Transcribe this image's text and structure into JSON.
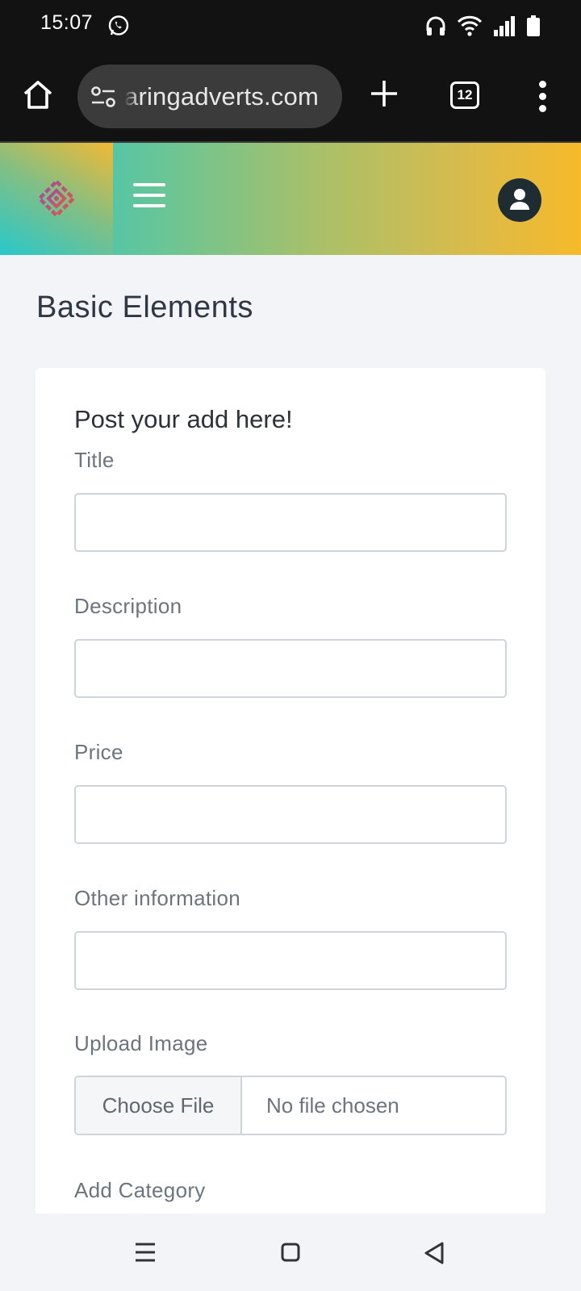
{
  "status_bar": {
    "time": "15:07",
    "icons": [
      "whatsapp-icon",
      "headphones-icon",
      "wifi-icon",
      "signal-icon",
      "battery-icon"
    ]
  },
  "browser": {
    "url": "aringadverts.com",
    "tab_count": "12",
    "icons": [
      "home-icon",
      "site-settings-icon",
      "plus-icon",
      "more-vert-icon"
    ]
  },
  "header": {
    "gradient_colors": [
      "#2fc4c6",
      "#a9c069",
      "#f6ba2a"
    ],
    "icons": [
      "brand-logo",
      "hamburger-icon",
      "user-icon"
    ]
  },
  "page": {
    "title": "Basic Elements"
  },
  "form": {
    "heading": "Post your add here!",
    "fields": {
      "title": {
        "label": "Title",
        "value": ""
      },
      "description": {
        "label": "Description",
        "value": ""
      },
      "price": {
        "label": "Price",
        "value": ""
      },
      "other": {
        "label": "Other information",
        "value": ""
      }
    },
    "upload": {
      "label": "Upload Image",
      "button": "Choose File",
      "status": "No file chosen"
    },
    "category": {
      "label": "Add Category"
    }
  },
  "nav_bar": {
    "icons": [
      "recents-icon",
      "home-nav-icon",
      "back-icon"
    ]
  }
}
